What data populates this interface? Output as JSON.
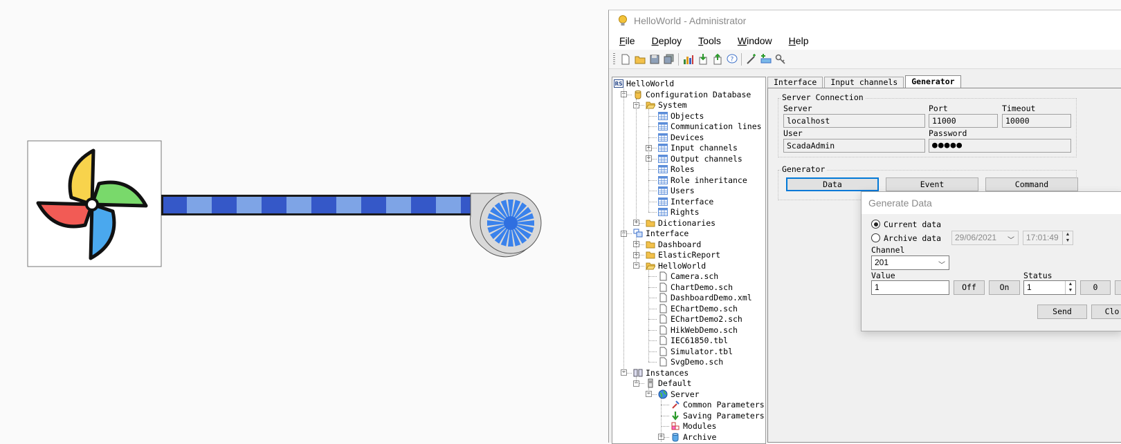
{
  "app": {
    "window_title": "HelloWorld - Administrator",
    "menu": [
      {
        "label": "File",
        "accel": "F",
        "rest": "ile"
      },
      {
        "label": "Deploy",
        "accel": "D",
        "rest": "eploy"
      },
      {
        "label": "Tools",
        "accel": "T",
        "rest": "ools"
      },
      {
        "label": "Window",
        "accel": "W",
        "rest": "indow"
      },
      {
        "label": "Help",
        "accel": "H",
        "rest": "elp"
      }
    ],
    "toolbar_icons": [
      "new-file-icon",
      "open-folder-icon",
      "save-icon",
      "save-all-icon",
      "chart-icon",
      "import-icon",
      "export-icon",
      "help-bubble-icon",
      "wand-icon",
      "add-line-icon",
      "key-icon"
    ],
    "colors": {
      "accent": "#0078d7",
      "folder": "#f3c14b",
      "table": "#5b8dd9"
    }
  },
  "tree": {
    "project": "HelloWorld",
    "project_badge": "RS",
    "config_db": "Configuration Database",
    "system": "System",
    "system_items": [
      "Objects",
      "Communication lines",
      "Devices",
      "Input channels",
      "Output channels",
      "Roles",
      "Role inheritance",
      "Users",
      "Interface",
      "Rights"
    ],
    "dictionaries": "Dictionaries",
    "interface": "Interface",
    "dashboard": "Dashboard",
    "elastic": "ElasticReport",
    "helloworld": "HelloWorld",
    "files": [
      "Camera.sch",
      "ChartDemo.sch",
      "DashboardDemo.xml",
      "EChartDemo.sch",
      "EChartDemo2.sch",
      "HikWebDemo.sch",
      "IEC61850.tbl",
      "Simulator.tbl",
      "SvgDemo.sch"
    ],
    "instances": "Instances",
    "default": "Default",
    "server": "Server",
    "server_items": [
      "Common Parameters",
      "Saving Parameters",
      "Modules",
      "Archive"
    ]
  },
  "tabs": [
    "Interface",
    "Input channels",
    "Generator"
  ],
  "server_connection": {
    "title": "Server Connection",
    "server_label": "Server",
    "server_value": "localhost",
    "port_label": "Port",
    "port_value": "11000",
    "timeout_label": "Timeout",
    "timeout_value": "10000",
    "user_label": "User",
    "user_value": "ScadaAdmin",
    "password_label": "Password",
    "password_mask": "●●●●●"
  },
  "generator": {
    "title": "Generator",
    "buttons": [
      "Data",
      "Event",
      "Command"
    ]
  },
  "dialog": {
    "title": "Generate Data",
    "current_data": "Current data",
    "archive_data": "Archive data",
    "date": "29/06/2021",
    "time": "17:01:49",
    "channel_label": "Channel",
    "channel_value": "201",
    "value_label": "Value",
    "value_value": "1",
    "off_label": "Off",
    "on_label": "On",
    "status_label": "Status",
    "status_value": "1",
    "zero_label": "0",
    "send_label": "Send",
    "close_label": "Clo"
  }
}
